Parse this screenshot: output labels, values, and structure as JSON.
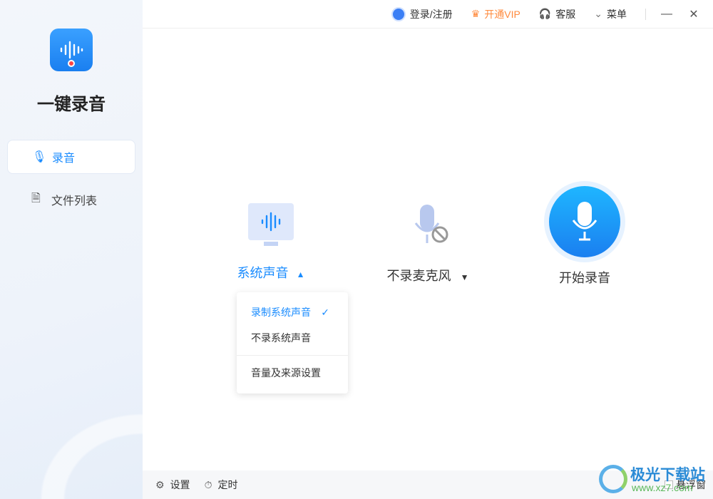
{
  "app": {
    "title": "一键录音"
  },
  "sidebar": {
    "items": [
      {
        "label": "录音",
        "icon": "microphone-icon",
        "active": true
      },
      {
        "label": "文件列表",
        "icon": "document-icon",
        "active": false
      }
    ]
  },
  "topbar": {
    "login": "登录/注册",
    "vip": "开通VIP",
    "service": "客服",
    "menu": "菜单"
  },
  "sources": {
    "system": "系统声音",
    "mic": "不录麦克风",
    "start": "开始录音"
  },
  "dropdown": {
    "items": [
      "录制系统声音",
      "不录系统声音",
      "音量及来源设置"
    ],
    "selected": 0
  },
  "footer": {
    "settings": "设置",
    "timer": "定时",
    "float": "悬浮窗"
  },
  "watermark": {
    "name": "极光下载站",
    "url": "www.xz7.com"
  },
  "colors": {
    "accent": "#1a8cff",
    "vip": "#ff8a3d"
  }
}
